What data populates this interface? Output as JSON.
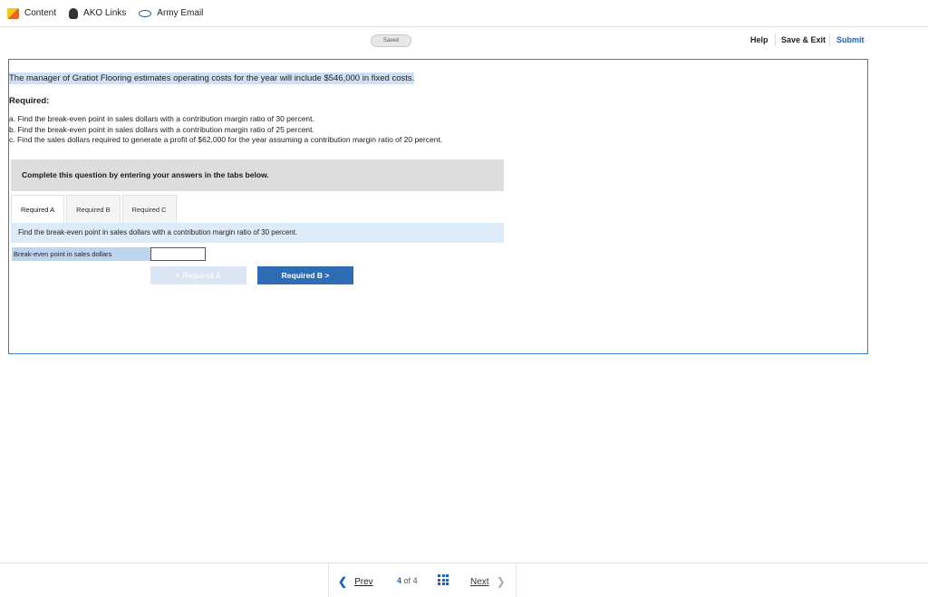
{
  "bookmarks": [
    {
      "label": "Content",
      "icon": "content-icon"
    },
    {
      "label": "AKO Links",
      "icon": "ako-icon"
    },
    {
      "label": "Army Email",
      "icon": "mail-icon"
    }
  ],
  "toolbar": {
    "saved_label": "Saved",
    "help_label": "Help",
    "save_exit_label": "Save & Exit",
    "submit_label": "Submit"
  },
  "question": {
    "stem": "The manager of Gratiot Flooring estimates operating costs for the year will include $546,000 in fixed costs.",
    "required_heading": "Required:",
    "items": [
      "a. Find the break-even point in sales dollars with a contribution margin ratio of 30 percent.",
      "b. Find the break-even point in sales dollars with a contribution margin ratio of 25 percent.",
      "c. Find the sales dollars required to generate a profit of $62,000 for the year assuming a contribution margin ratio of 20 percent."
    ],
    "instruction": "Complete this question by entering your answers in the tabs below."
  },
  "tabs": [
    {
      "label": "Required A",
      "active": true
    },
    {
      "label": "Required B",
      "active": false
    },
    {
      "label": "Required C",
      "active": false
    }
  ],
  "panel": {
    "description": "Find the break-even point in sales dollars with a contribution margin ratio of 30 percent.",
    "answer_label": "Break-even point in sales dollars",
    "answer_value": "",
    "prev_button": "<  Required A",
    "next_button": "Required B  >"
  },
  "footer": {
    "prev_label": "Prev",
    "page_current": "4",
    "page_of": "of",
    "page_total": "4",
    "next_label": "Next"
  },
  "colors": {
    "accent": "#1e63b8",
    "question_border": "#3e7cc4",
    "highlight": "#cfe0f5"
  }
}
